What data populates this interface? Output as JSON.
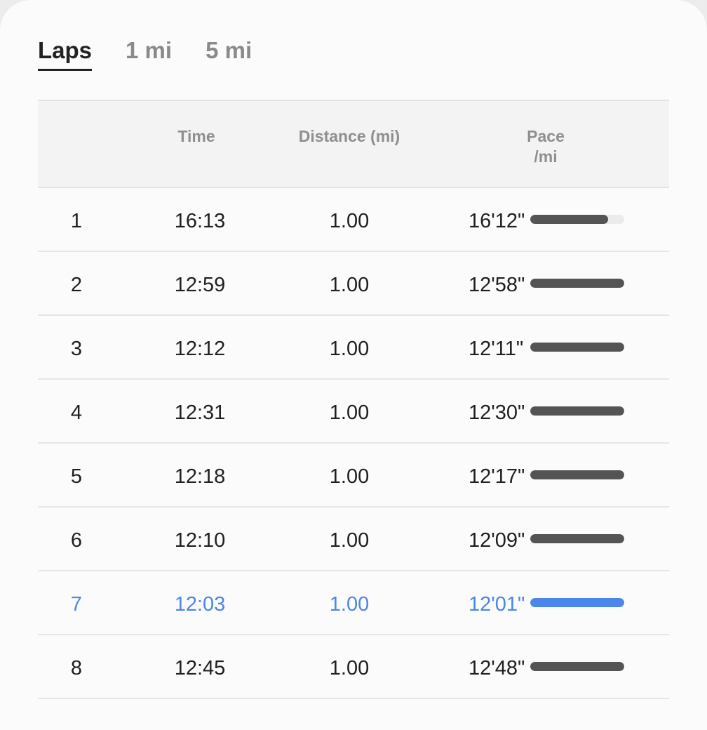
{
  "tabs": [
    {
      "label": "Laps",
      "active": true
    },
    {
      "label": "1 mi",
      "active": false
    },
    {
      "label": "5 mi",
      "active": false
    }
  ],
  "table": {
    "headers": {
      "lap": "",
      "time": "Time",
      "distance": "Distance (mi)",
      "pace": "Pace\n/mi"
    },
    "rows": [
      {
        "lap": "1",
        "time": "16:13",
        "distance": "1.00",
        "pace": "16'12\"",
        "bar_fraction": 0.83,
        "highlight": false
      },
      {
        "lap": "2",
        "time": "12:59",
        "distance": "1.00",
        "pace": "12'58\"",
        "bar_fraction": 1.0,
        "highlight": false
      },
      {
        "lap": "3",
        "time": "12:12",
        "distance": "1.00",
        "pace": "12'11\"",
        "bar_fraction": 1.0,
        "highlight": false
      },
      {
        "lap": "4",
        "time": "12:31",
        "distance": "1.00",
        "pace": "12'30\"",
        "bar_fraction": 1.0,
        "highlight": false
      },
      {
        "lap": "5",
        "time": "12:18",
        "distance": "1.00",
        "pace": "12'17\"",
        "bar_fraction": 1.0,
        "highlight": false
      },
      {
        "lap": "6",
        "time": "12:10",
        "distance": "1.00",
        "pace": "12'09\"",
        "bar_fraction": 1.0,
        "highlight": false
      },
      {
        "lap": "7",
        "time": "12:03",
        "distance": "1.00",
        "pace": "12'01\"",
        "bar_fraction": 1.0,
        "highlight": true
      },
      {
        "lap": "8",
        "time": "12:45",
        "distance": "1.00",
        "pace": "12'48\"",
        "bar_fraction": 1.0,
        "highlight": false
      }
    ]
  },
  "colors": {
    "highlight": "#4b86ea",
    "bar": "#545454",
    "bar_track": "#ebebeb"
  }
}
